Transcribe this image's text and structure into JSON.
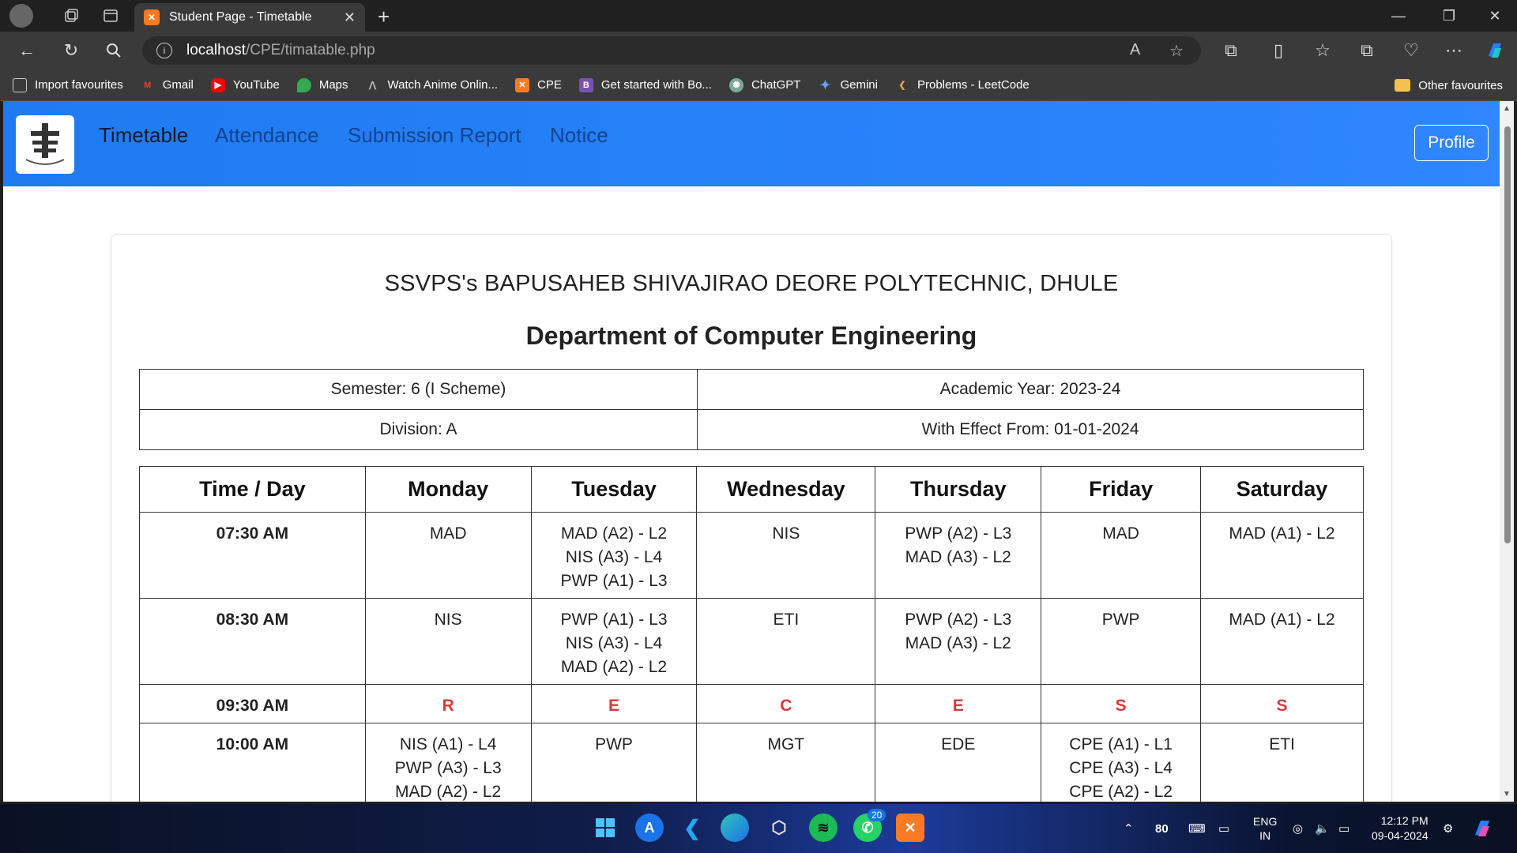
{
  "browser": {
    "tab_title": "Student Page - Timetable",
    "url_host": "localhost",
    "url_path": "/CPE/timatable.php",
    "favourites": [
      {
        "label": "Import favourites",
        "icon": "import-icon",
        "color": "#cfcfcf"
      },
      {
        "label": "Gmail",
        "icon": "gmail-icon",
        "color": "#ea4335"
      },
      {
        "label": "YouTube",
        "icon": "youtube-icon",
        "color": "#ff0000"
      },
      {
        "label": "Maps",
        "icon": "maps-icon",
        "color": "#34a853"
      },
      {
        "label": "Watch Anime Onlin...",
        "icon": "anime-icon",
        "color": "#cfcfcf"
      },
      {
        "label": "CPE",
        "icon": "xampp-icon",
        "color": "#fb7a24"
      },
      {
        "label": "Get started with Bo...",
        "icon": "bootstrap-icon",
        "color": "#7952b3"
      },
      {
        "label": "ChatGPT",
        "icon": "chatgpt-icon",
        "color": "#7fa89a"
      },
      {
        "label": "Gemini",
        "icon": "gemini-icon",
        "color": "#6e9cff"
      },
      {
        "label": "Problems - LeetCode",
        "icon": "leetcode-icon",
        "color": "#f0a43a"
      }
    ],
    "other_favourites": "Other favourites"
  },
  "nav": {
    "links": [
      "Timetable",
      "Attendance",
      "Submission Report",
      "Notice"
    ],
    "profile": "Profile"
  },
  "header": {
    "institute": "SSVPS's BAPUSAHEB SHIVAJIRAO DEORE POLYTECHNIC, DHULE",
    "department": "Department of Computer Engineering"
  },
  "info": {
    "semester": "Semester: 6 (I Scheme)",
    "academic_year": "Academic Year: 2023-24",
    "division": "Division: A",
    "effect_from": "With Effect From: 01-01-2024"
  },
  "timetable": {
    "headers": [
      "Time / Day",
      "Monday",
      "Tuesday",
      "Wednesday",
      "Thursday",
      "Friday",
      "Saturday"
    ],
    "rows": [
      {
        "time": "07:30 AM",
        "cells": [
          [
            "MAD"
          ],
          [
            "MAD (A2) - L2",
            "NIS (A3) - L4",
            "PWP (A1) - L3"
          ],
          [
            "NIS"
          ],
          [
            "PWP (A2) - L3",
            "MAD (A3) - L2"
          ],
          [
            "MAD"
          ],
          [
            "MAD (A1) - L2"
          ]
        ]
      },
      {
        "time": "08:30 AM",
        "cells": [
          [
            "NIS"
          ],
          [
            "PWP (A1) - L3",
            "NIS (A3) - L4",
            "MAD (A2) - L2"
          ],
          [
            "ETI"
          ],
          [
            "PWP (A2) - L3",
            "MAD (A3) - L2"
          ],
          [
            "PWP"
          ],
          [
            "MAD (A1) - L2"
          ]
        ]
      },
      {
        "time": "09:30 AM",
        "recess": true,
        "cells": [
          [
            "R"
          ],
          [
            "E"
          ],
          [
            "C"
          ],
          [
            "E"
          ],
          [
            "S"
          ],
          [
            "S"
          ]
        ]
      },
      {
        "time": "10:00 AM",
        "cells": [
          [
            "NIS (A1) - L4",
            "PWP (A3) - L3",
            "MAD (A2) - L2"
          ],
          [
            "PWP"
          ],
          [
            "MGT"
          ],
          [
            "EDE"
          ],
          [
            "CPE (A1) - L1",
            "CPE (A3) - L4",
            "CPE (A2) - L2"
          ],
          [
            "ETI"
          ]
        ]
      }
    ]
  },
  "taskbar": {
    "weather_temp": "80",
    "lang": "ENG",
    "region": "IN",
    "time": "12:12 PM",
    "date": "09-04-2024",
    "whatsapp_badge": "20"
  }
}
